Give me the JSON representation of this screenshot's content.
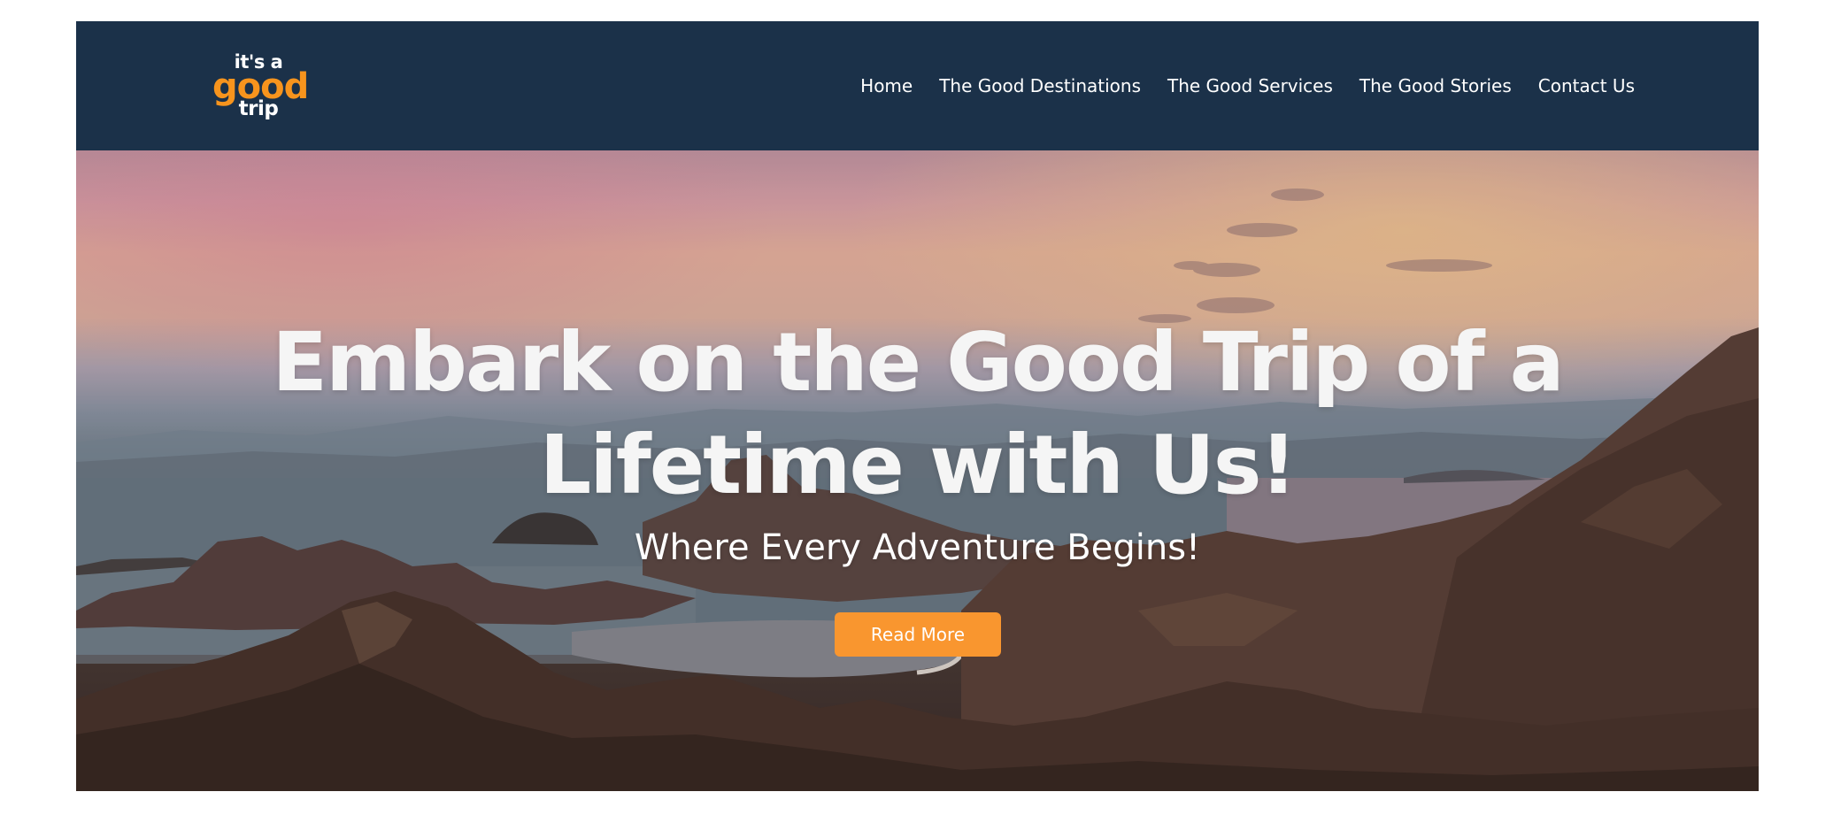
{
  "logo": {
    "line1": "it's a",
    "line2": "good",
    "line3": "trip"
  },
  "nav": {
    "items": [
      {
        "label": "Home"
      },
      {
        "label": "The Good Destinations"
      },
      {
        "label": "The Good Services"
      },
      {
        "label": "The Good Stories"
      },
      {
        "label": "Contact Us"
      }
    ]
  },
  "hero": {
    "title_line1": "Embark on the Good Trip of a",
    "title_line2": "Lifetime with Us!",
    "subtitle": "Where Every Adventure Begins!",
    "cta_label": "Read More",
    "image": "mountain-islands-sunset-photo"
  },
  "colors": {
    "navbar_bg": "#1b3149",
    "accent": "#f9962f",
    "logo_orange": "#f7941d",
    "text_light": "#ffffff"
  }
}
